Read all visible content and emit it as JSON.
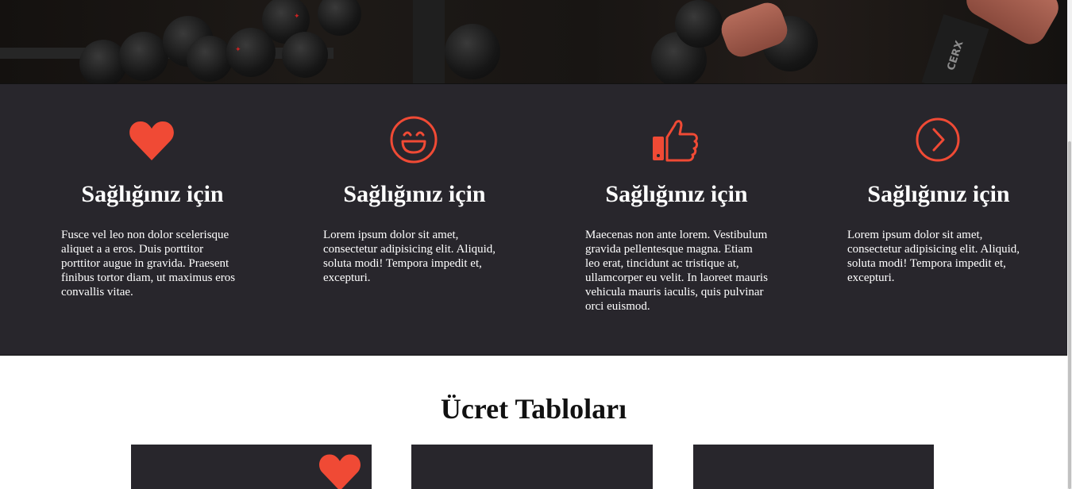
{
  "hero": {
    "brand_text": "CERX"
  },
  "features": [
    {
      "icon": "heart-icon",
      "title": "Sağlığınız için",
      "text": "Fusce vel leo non dolor scelerisque aliquet a a eros. Duis porttitor porttitor augue in gravida. Praesent finibus tortor diam, ut maximus eros convallis vitae."
    },
    {
      "icon": "smile-icon",
      "title": "Sağlığınız için",
      "text": "Lorem ipsum dolor sit amet, consectetur adipisicing elit. Aliquid, soluta modi! Tempora impedit et, excepturi."
    },
    {
      "icon": "thumbs-up-icon",
      "title": "Sağlığınız için",
      "text": "Maecenas non ante lorem. Vestibulum gravida pellentesque magna. Etiam leo erat, tincidunt ac tristique at, ullamcorper eu velit. In laoreet mauris vehicula mauris iaculis, quis pulvinar orci euismod."
    },
    {
      "icon": "chevron-right-circle-icon",
      "title": "Sağlığınız için",
      "text": "Lorem ipsum dolor sit amet, consectetur adipisicing elit. Aliquid, soluta modi! Tempora impedit et, excepturi."
    }
  ],
  "pricing": {
    "title": "Ücret Tabloları",
    "card_icon": "heart-icon"
  },
  "colors": {
    "accent": "#f04a35",
    "dark_bg": "#28262c",
    "text_light": "#ffffff"
  }
}
